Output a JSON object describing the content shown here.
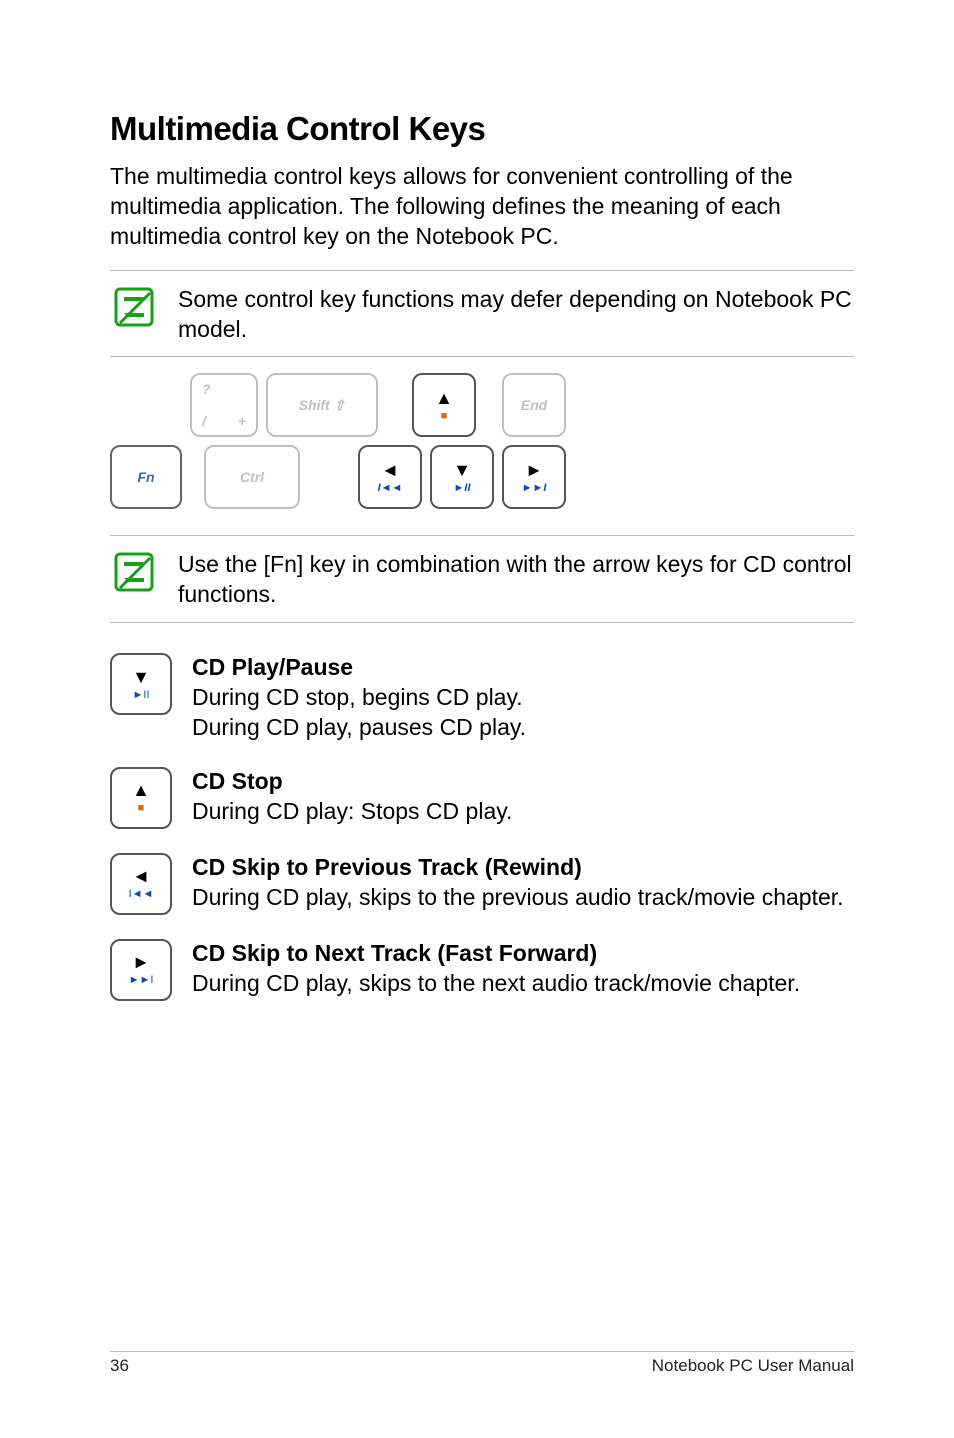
{
  "heading": "Multimedia Control Keys",
  "intro": "The multimedia control keys allows for convenient controlling of the multimedia application. The following defines the meaning of each multimedia control key on the Notebook PC.",
  "note1": "Some control key functions may defer depending on Notebook PC model.",
  "note2": "Use the [Fn] key in combination with the arrow keys for CD control functions.",
  "keys": {
    "fn": "Fn",
    "slash_top": "?",
    "slash_bl": "/",
    "slash_br": "+",
    "shift": "Shift ⇧",
    "ctrl": "Ctrl",
    "end": "End",
    "up_tri": "▲",
    "up_media": "■",
    "down_tri": "▼",
    "down_media": "►II",
    "left_tri": "◄",
    "left_media": "I◄◄",
    "right_tri": "►",
    "right_media": "►►I"
  },
  "features": {
    "play_title": "CD Play/Pause",
    "play_l1": "During CD stop, begins CD play.",
    "play_l2": "During CD play, pauses CD play.",
    "stop_title": "CD Stop",
    "stop_l1": "During CD play: Stops CD play.",
    "prev_title": "CD Skip to Previous Track (Rewind)",
    "prev_l1": "During CD play, skips to the previous audio track/movie chapter.",
    "next_title": "CD Skip to Next Track (Fast Forward)",
    "next_l1": "During CD play, skips to the next audio track/movie chapter."
  },
  "footer": {
    "page": "36",
    "doc": "Notebook PC User Manual"
  }
}
